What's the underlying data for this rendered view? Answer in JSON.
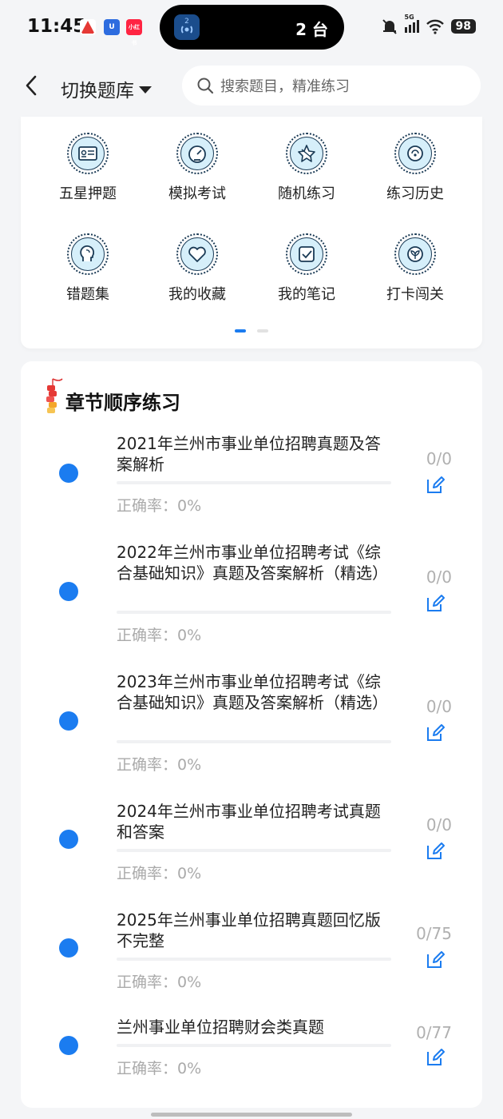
{
  "status_bar": {
    "time": "11:45",
    "island_text": "2 台",
    "island_icon_badge": "2",
    "network": "5G",
    "battery": "98",
    "app_icons": [
      "red-triangle-app-icon",
      "blue-u-app-icon",
      "xiaohongshu-app-icon"
    ],
    "app_icon_texts": [
      "",
      "U",
      "小红书"
    ]
  },
  "header": {
    "switch_label": "切换题库",
    "search_placeholder": "搜索题目，精准练习"
  },
  "shortcuts": [
    {
      "label": "五星押题",
      "icon": "id-card-icon"
    },
    {
      "label": "模拟考试",
      "icon": "gauge-icon"
    },
    {
      "label": "随机练习",
      "icon": "random-star-icon"
    },
    {
      "label": "练习历史",
      "icon": "history-icon"
    },
    {
      "label": "错题集",
      "icon": "head-profile-icon"
    },
    {
      "label": "我的收藏",
      "icon": "heart-icon"
    },
    {
      "label": "我的笔记",
      "icon": "note-check-icon"
    },
    {
      "label": "打卡闯关",
      "icon": "leaf-badge-icon"
    }
  ],
  "colors": {
    "accent": "#1b7cf0",
    "icon_fill": "#d6effa",
    "icon_stroke": "#1a3a55"
  },
  "chapter_section": {
    "title": "章节顺序练习",
    "items": [
      {
        "title": "2021年兰州市事业单位招聘真题及答案解析",
        "rate": "正确率：0%",
        "count": "0/0",
        "progress": 0
      },
      {
        "title": "2022年兰州市事业单位招聘考试《综合基础知识》真题及答案解析（精选）",
        "rate": "正确率：0%",
        "count": "0/0",
        "progress": 0
      },
      {
        "title": "2023年兰州市事业单位招聘考试《综合基础知识》真题及答案解析（精选）",
        "rate": "正确率：0%",
        "count": "0/0",
        "progress": 0
      },
      {
        "title": "2024年兰州市事业单位招聘考试真题和答案",
        "rate": "正确率：0%",
        "count": "0/0",
        "progress": 0
      },
      {
        "title": "2025年兰州事业单位招聘真题回忆版不完整",
        "rate": "正确率：0%",
        "count": "0/75",
        "progress": 0
      },
      {
        "title": "兰州事业单位招聘财会类真题",
        "rate": "正确率：0%",
        "count": "0/77",
        "progress": 0
      }
    ]
  }
}
